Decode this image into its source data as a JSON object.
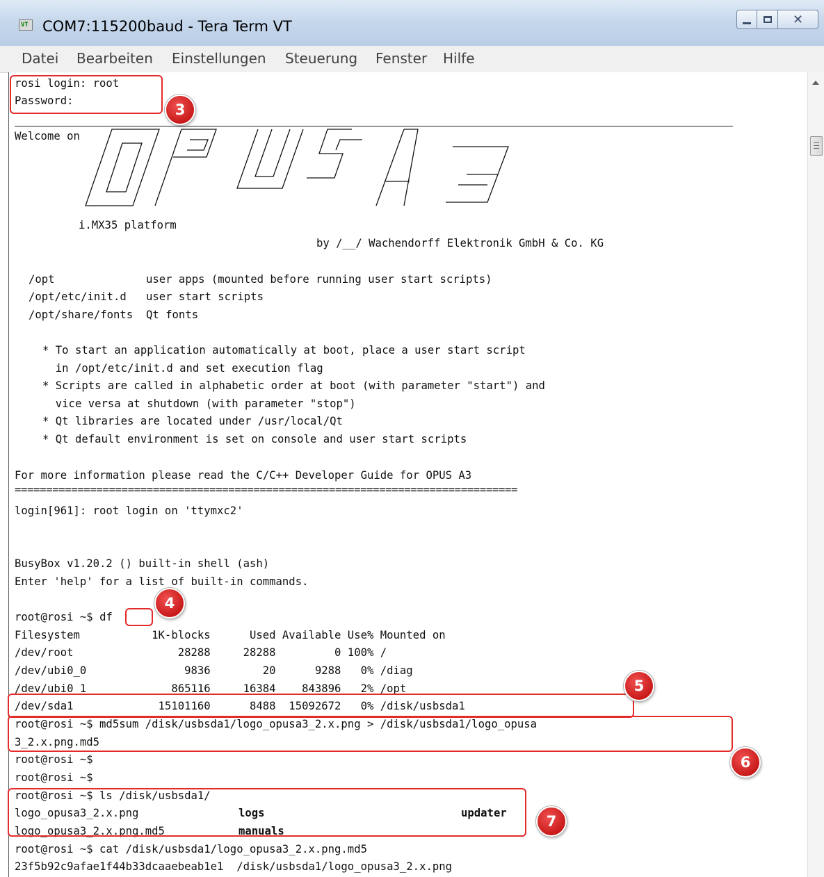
{
  "window": {
    "title": "COM7:115200baud - Tera Term VT",
    "icon_text": "VT"
  },
  "menu": [
    "Datei",
    "Bearbeiten",
    "Einstellungen",
    "Steuerung",
    "Fenster",
    "Hilfe"
  ],
  "terminal": {
    "login_line": "rosi login: root",
    "password_line": "Password:",
    "welcome_prefix": "Welcome on",
    "platform": "i.MX35 platform",
    "byline": "by /__/ Wachendorff Elektronik GmbH & Co. KG",
    "paths": [
      "/opt              user apps (mounted before running user start scripts)",
      "/opt/etc/init.d   user start scripts",
      "/opt/share/fonts  Qt fonts"
    ],
    "notes": [
      "* To start an application automatically at boot, place a user start script",
      "  in /opt/etc/init.d and set execution flag",
      "* Scripts are called in alphabetic order at boot (with parameter \"start\") and",
      "  vice versa at shutdown (with parameter \"stop\")",
      "* Qt libraries are located under /usr/local/Qt",
      "* Qt default environment is set on console and user start scripts"
    ],
    "more_info": "For more information please read the C/C++ Developer Guide for OPUS A3",
    "separator": "================================================================================",
    "login_msg": "login[961]: root login on 'ttymxc2'",
    "busybox": "BusyBox v1.20.2 () built-in shell (ash)",
    "help_hint": "Enter 'help' for a list of built-in commands.",
    "prompt": "root@rosi ~$ ",
    "cmd_df": "df",
    "df_header": "Filesystem           1K-blocks      Used Available Use% Mounted on",
    "df_rows": [
      "/dev/root                28288     28288         0 100% /",
      "/dev/ubi0_0               9836        20      9288   0% /diag",
      "/dev/ubi0_1             865116     16384    843896   2% /opt",
      "/dev/sda1             15101160      8488  15092672   0% /disk/usbsda1"
    ],
    "md5_cmd_1": "root@rosi ~$ md5sum /disk/usbsda1/logo_opusa3_2.x.png > /disk/usbsda1/logo_opusa",
    "md5_cmd_2": "3_2.x.png.md5",
    "empty_prompt": "root@rosi ~$",
    "ls_cmd": "root@rosi ~$ ls /disk/usbsda1/",
    "ls_row1_file": "logo_opusa3_2.x.png",
    "ls_row1_dir1": "logs",
    "ls_row1_dir2": "updater",
    "ls_row2_file": "logo_opusa3_2.x.png.md5",
    "ls_row2_dir1": "manuals",
    "cat_cmd": "root@rosi ~$ cat /disk/usbsda1/logo_opusa3_2.x.png.md5",
    "cat_out": "23f5b92c9afae1f44b33dcaaebeab1e1  /disk/usbsda1/logo_opusa3_2.x.png"
  },
  "annotations": {
    "step3": "3",
    "step4": "4",
    "step5": "5",
    "step6": "6",
    "step7": "7",
    "color": "#e42b2b"
  }
}
